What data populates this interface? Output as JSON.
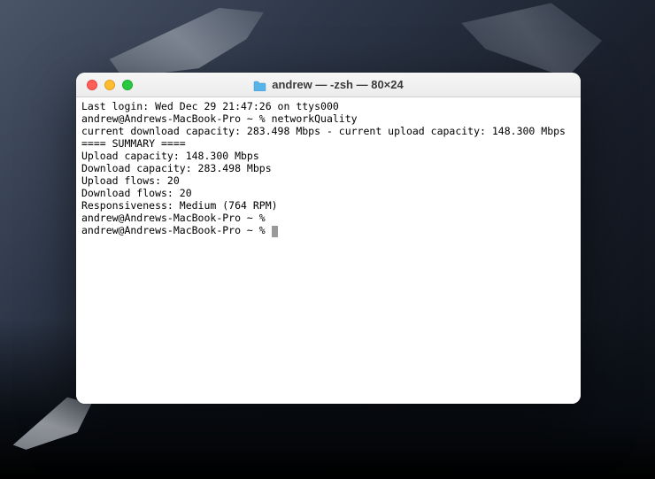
{
  "window": {
    "title": "andrew — -zsh — 80×24"
  },
  "terminal": {
    "last_login": "Last login: Wed Dec 29 21:47:26 on ttys000",
    "prompt1": "andrew@Andrews-MacBook-Pro ~ % networkQuality",
    "realtime": "current download capacity: 283.498 Mbps - current upload capacity: 148.300 Mbps",
    "summary_header": "==== SUMMARY ====",
    "blank": "",
    "upload_cap": "Upload capacity: 148.300 Mbps",
    "download_cap": "Download capacity: 283.498 Mbps",
    "upload_flows": "Upload flows: 20",
    "download_flows": "Download flows: 20",
    "responsiveness": "Responsiveness: Medium (764 RPM)",
    "prompt2": "andrew@Andrews-MacBook-Pro ~ % ",
    "prompt3": "andrew@Andrews-MacBook-Pro ~ % "
  }
}
